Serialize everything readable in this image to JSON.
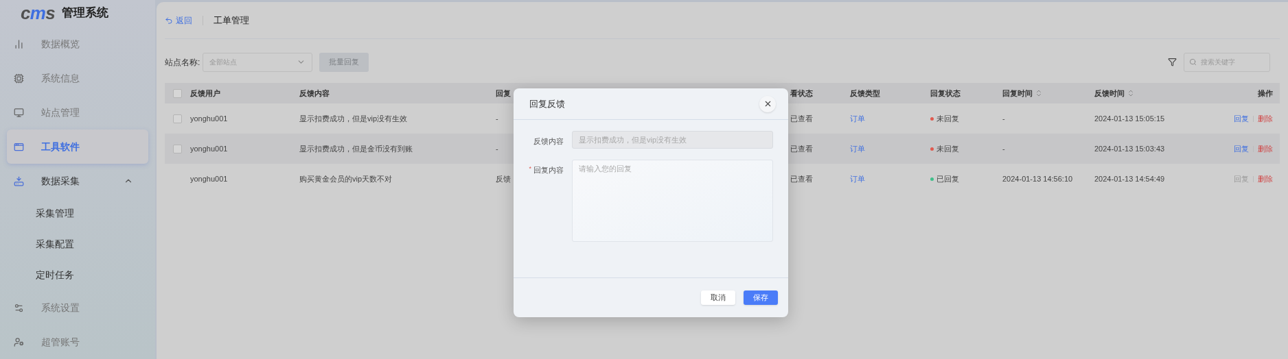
{
  "sidebar": {
    "logo_mark": "cms",
    "title": "管理系统",
    "items": [
      {
        "label": "数据概览",
        "selected": false
      },
      {
        "label": "系统信息",
        "selected": false
      },
      {
        "label": "站点管理",
        "selected": false
      },
      {
        "label": "工具软件",
        "selected": true
      },
      {
        "label": "数据采集",
        "selected": false,
        "expanded": true,
        "children": [
          {
            "label": "采集管理",
            "selected": false
          },
          {
            "label": "采集配置",
            "selected": false
          },
          {
            "label": "定时任务",
            "selected": false
          }
        ]
      },
      {
        "label": "系统设置",
        "selected": false
      },
      {
        "label": "超管账号",
        "selected": false
      }
    ]
  },
  "header": {
    "back": "返回",
    "title": "工单管理"
  },
  "toolbar": {
    "site_label": "站点名称:",
    "site_select": {
      "placeholder": "全部站点"
    },
    "batch_button": {
      "label": "批量回复",
      "disabled": true
    },
    "search": {
      "placeholder": "搜索关键字"
    }
  },
  "table": {
    "header_checkbox": {
      "checked": false
    },
    "columns": [
      {
        "label": "反馈用户",
        "sortable": false
      },
      {
        "label": "反馈内容",
        "sortable": false
      },
      {
        "label": "回复"
      },
      {
        "label": "看状态",
        "sortable": false
      },
      {
        "label": "反馈类型",
        "sortable": false
      },
      {
        "label": "回复状态",
        "sortable": false
      },
      {
        "label": "回复时间",
        "sortable": true
      },
      {
        "label": "反馈时间",
        "sortable": true
      },
      {
        "label": "操作",
        "sortable": false
      }
    ],
    "rows": [
      {
        "selectable": true,
        "checked": false,
        "user": "yonghu001",
        "content": "显示扣费成功，但是vip没有生效",
        "reply": "-",
        "view_status": "已查看",
        "type": "订单",
        "reply_status": {
          "label": "未回复",
          "color": "#e05a4f"
        },
        "reply_time": "-",
        "feedback_time": "2024-01-13 15:05:15",
        "actions": [
          {
            "label": "回复",
            "kind": "reply",
            "disabled": false
          },
          {
            "label": "删除",
            "kind": "delete",
            "disabled": false
          }
        ]
      },
      {
        "selectable": true,
        "checked": false,
        "user": "yonghu001",
        "content": "显示扣费成功，但是金币没有到账",
        "reply": "-",
        "view_status": "已查看",
        "type": "订单",
        "reply_status": {
          "label": "未回复",
          "color": "#e05a4f"
        },
        "reply_time": "-",
        "feedback_time": "2024-01-13 15:03:43",
        "actions": [
          {
            "label": "回复",
            "kind": "reply",
            "disabled": false
          },
          {
            "label": "删除",
            "kind": "delete",
            "disabled": false
          }
        ]
      },
      {
        "selectable": false,
        "user": "yonghu001",
        "content": "购买黄金会员的vip天数不对",
        "reply": "反馈",
        "view_status": "已查看",
        "type": "订单",
        "reply_status": {
          "label": "已回复",
          "color": "#3fbf8a"
        },
        "reply_time": "2024-01-13 14:56:10",
        "feedback_time": "2024-01-13 14:54:49",
        "actions": [
          {
            "label": "回复",
            "kind": "reply",
            "disabled": true
          },
          {
            "label": "删除",
            "kind": "delete",
            "disabled": false
          }
        ]
      }
    ]
  },
  "dialog": {
    "title": "回复反馈",
    "fields": [
      {
        "label": "反馈内容",
        "required": false,
        "kind": "readonly",
        "value": "显示扣费成功，但是vip没有生效"
      },
      {
        "label": "回复内容",
        "required": true,
        "required_mark": "*",
        "kind": "textarea",
        "placeholder": "请输入您的回复"
      }
    ],
    "buttons": [
      {
        "label": "取消",
        "kind": "secondary"
      },
      {
        "label": "保存",
        "kind": "primary"
      }
    ]
  }
}
